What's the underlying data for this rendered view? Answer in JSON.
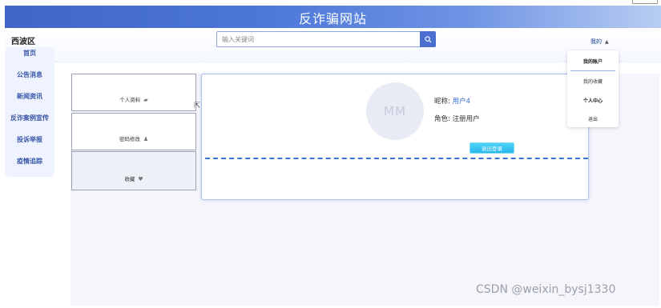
{
  "header": {
    "title": "反诈骗网站"
  },
  "topbar": {
    "brand": "西波区",
    "search": {
      "placeholder": "输入关键词",
      "value": ""
    },
    "user_menu": "我的"
  },
  "sidebar": {
    "items": [
      {
        "label": "首页"
      },
      {
        "label": "公告消息"
      },
      {
        "label": "新闻资讯"
      },
      {
        "label": "反诈案例宣传"
      },
      {
        "label": "投诉举报"
      },
      {
        "label": "疫情追踪"
      }
    ]
  },
  "tabs": [
    {
      "label": "个人资料",
      "icon": "briefcase-icon"
    },
    {
      "label": "密码修改",
      "icon": "user-icon"
    },
    {
      "label": "收藏",
      "icon": "heart-icon"
    }
  ],
  "profile": {
    "avatar_text": "MM",
    "nickname_label": "昵称:",
    "nickname": "用户4",
    "role_label": "角色:",
    "role": "注册用户",
    "logout_label": "退出登录"
  },
  "dropdown": {
    "items": [
      {
        "label": "我的账户"
      },
      {
        "label": "我的收藏"
      },
      {
        "label": "个人中心"
      },
      {
        "label": "退出"
      }
    ]
  },
  "watermark": "CSDN @weixin_bysj1330",
  "colors": {
    "accent": "#4a6fd0",
    "link": "#3a6ed8",
    "logout": "#27b7ee"
  }
}
